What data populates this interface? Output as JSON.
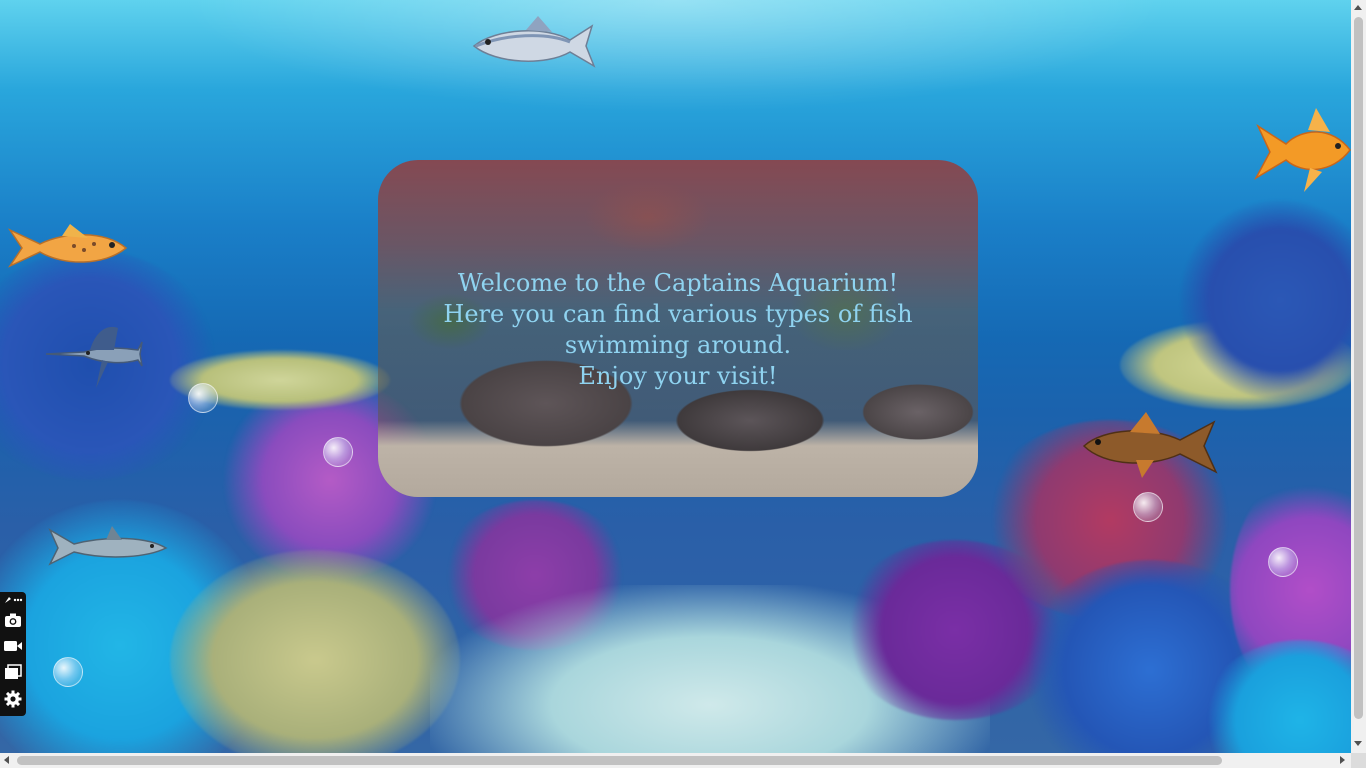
{
  "page": {
    "welcome_lines": [
      "Welcome to the Captains Aquarium!",
      "Here you can find various types of fish swimming around.",
      "Enjoy your visit!"
    ]
  },
  "fish": [
    {
      "name": "trout-fish"
    },
    {
      "name": "goldfish"
    },
    {
      "name": "spotted-orange-fish"
    },
    {
      "name": "swordfish"
    },
    {
      "name": "brown-carp-fish"
    },
    {
      "name": "shark-fish"
    }
  ],
  "recorder_toolbar": {
    "items": [
      "pin-more-icon",
      "camera-icon",
      "video-icon",
      "window-icon",
      "gear-icon"
    ]
  },
  "colors": {
    "welcome_text": "#8fd3f0",
    "water_top": "#5fd2ee",
    "water_deep": "#1569b4"
  }
}
